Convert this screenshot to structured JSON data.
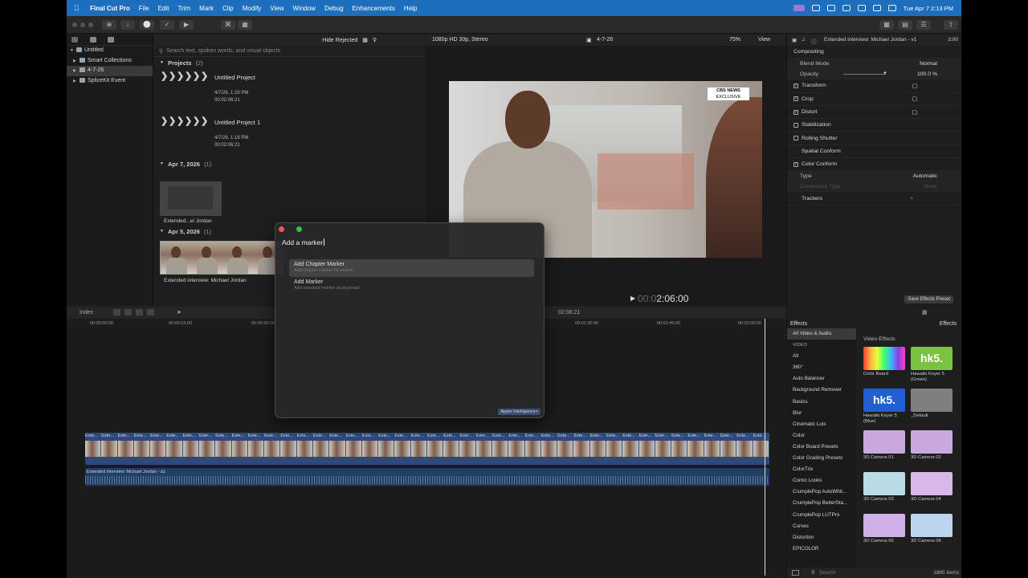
{
  "menubar": {
    "app_name": "Final Cut Pro",
    "items": [
      "File",
      "Edit",
      "Trim",
      "Mark",
      "Clip",
      "Modify",
      "View",
      "Window",
      "Debug",
      "Enhancements",
      "Help"
    ],
    "clock": "Tue Apr 7  2:13 PM"
  },
  "library": {
    "items": [
      {
        "label": "Untitled"
      },
      {
        "label": "Smart Collections"
      },
      {
        "label": "4-7-26"
      },
      {
        "label": "SpliceKit Event"
      }
    ]
  },
  "browser": {
    "filter_label": "Hide Rejected",
    "search_placeholder": "Search text, spoken words, and visual objects",
    "projects_heading": "Projects",
    "projects_count": "(2)",
    "projects": [
      {
        "name": "Untitled Project",
        "date": "4/7/26, 1:29 PM",
        "duration": "00:02:06:21"
      },
      {
        "name": "Untitled Project 1",
        "date": "4/7/26, 1:19 PM",
        "duration": "00:02:06:21"
      }
    ],
    "group1_heading": "Apr 7, 2026",
    "group1_count": "(1)",
    "group1_clip": "Extended...el Jordan",
    "group2_heading": "Apr 5, 2026",
    "group2_count": "(1)",
    "group2_clip": "Extended interview: Michael Jordan"
  },
  "viewer": {
    "format": "1080p HD 30p, Stereo",
    "project": "4-7-26",
    "zoom": "75%",
    "view_label": "View",
    "badge_line1": "CBS NEWS",
    "badge_line2": "EXCLUSIVE",
    "timecode_dim": "00:0",
    "timecode": "2:06:00"
  },
  "inspector": {
    "title": "Extended interview: Michael Jordan - v1",
    "duration": "3:00",
    "compositing": "Compositing",
    "blend_mode_label": "Blend Mode",
    "blend_mode_value": "Normal",
    "opacity_label": "Opacity",
    "opacity_value": "100.0",
    "opacity_unit": "%",
    "sections": [
      {
        "label": "Transform",
        "checked": true
      },
      {
        "label": "Crop",
        "checked": true
      },
      {
        "label": "Distort",
        "checked": true
      },
      {
        "label": "Stabilization",
        "checked": false
      },
      {
        "label": "Rolling Shutter",
        "checked": false
      }
    ],
    "spatial_conform": "Spatial Conform",
    "color_conform": "Color Conform",
    "type_label": "Type",
    "type_value": "Automatic",
    "conversion_label": "Conversion Type",
    "conversion_value": "None",
    "trackers": "Trackers",
    "save_preset": "Save Effects Preset"
  },
  "timeline": {
    "index_label": "Index",
    "position": "02:06:21",
    "ruler": [
      "00:00:00:00",
      "00:00:15:00",
      "00:00:30:00",
      "00:01:30:00",
      "00:01:45:00",
      "00:02:00:00"
    ],
    "clip_label": "Exte...",
    "audio_label": "Extended interview: Michael Jordan - a1"
  },
  "effects": {
    "header": "Effects",
    "header_right": "Effects",
    "categories": [
      "All Video & Audio",
      "VIDEO",
      "All",
      "360°",
      "Auto Balancer",
      "Background Remover",
      "Basics",
      "Blur",
      "Cinematic Luts",
      "Color",
      "Color Board Presets",
      "Color Grading Presets",
      "ColorTrix",
      "Comic Looks",
      "CrumplePop AutoWhit...",
      "CrumplePop BetterSta...",
      "CrumplePop LUTPro",
      "Curves",
      "Distortion",
      "EPICOLOR"
    ],
    "section_title": "Video Effects",
    "items": [
      {
        "label": "Color Board",
        "color": "#8a3fe0"
      },
      {
        "label": "Hawaiki Keyer 5 (Green)",
        "color": "#7bc142"
      },
      {
        "label": "Hawaiki Keyer 5 (Blue)",
        "color": "#1f5fcf"
      },
      {
        "label": "_Default",
        "color": "#7f7f7f"
      },
      {
        "label": "3D Camera 01",
        "color": "#c9a8e0"
      },
      {
        "label": "3D Camera 02",
        "color": "#c9a8e0"
      },
      {
        "label": "3D Camera 03",
        "color": "#b9dbe6"
      },
      {
        "label": "3D Camera 04",
        "color": "#d7b8e8"
      },
      {
        "label": "3D Camera 05",
        "color": "#d0b0e8"
      },
      {
        "label": "3D Camera 06",
        "color": "#bcd4ec"
      }
    ],
    "hk5_text": "hk5.",
    "search_placeholder": "Search",
    "count": "1885 items"
  },
  "dialog": {
    "input_value": "Add a marker",
    "suggestions": [
      {
        "title": "Add Chapter Marker",
        "desc": "Add chapter marker for export"
      },
      {
        "title": "Add Marker",
        "desc": "Add standard marker at playhead"
      }
    ],
    "ai_label": "Apple Intelligence+"
  }
}
